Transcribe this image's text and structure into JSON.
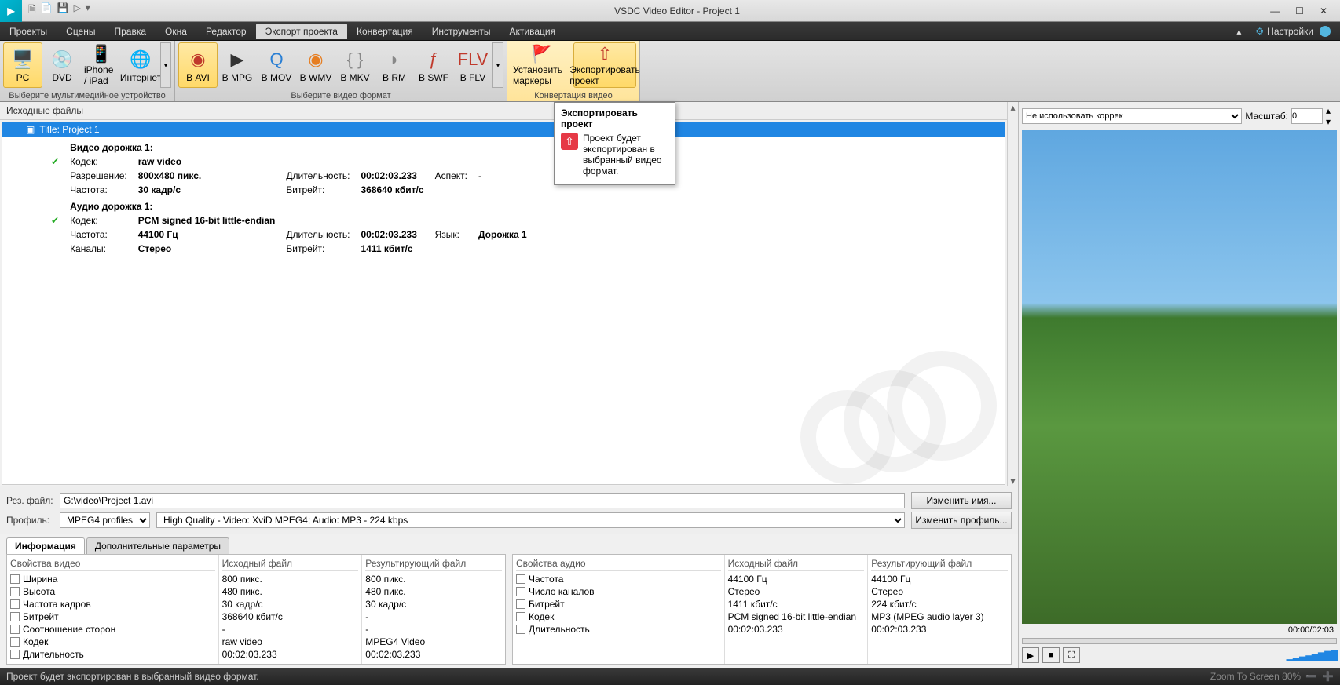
{
  "app": {
    "title": "VSDC Video Editor - Project 1"
  },
  "menu": {
    "items": [
      "Проекты",
      "Сцены",
      "Правка",
      "Окна",
      "Редактор",
      "Экспорт проекта",
      "Конвертация",
      "Инструменты",
      "Активация"
    ],
    "active": 5,
    "settings": "Настройки"
  },
  "ribbon": {
    "devices": {
      "label": "Выберите мультимедийное устройство",
      "items": [
        {
          "t": "PC",
          "ic": "🖥️",
          "sel": true
        },
        {
          "t": "DVD",
          "ic": "💿"
        },
        {
          "t": "iPhone / iPad",
          "ic": "📱"
        },
        {
          "t": "Интернет",
          "ic": "🌐"
        }
      ]
    },
    "formats": {
      "label": "Выберите видео формат",
      "items": [
        {
          "t": "В AVI",
          "ic": "◉",
          "sel": true,
          "col": "#c0392b"
        },
        {
          "t": "В MPG",
          "ic": "▶",
          "col": "#333"
        },
        {
          "t": "В MOV",
          "ic": "Q",
          "col": "#2a7fd4"
        },
        {
          "t": "В WMV",
          "ic": "◉",
          "col": "#e67e22"
        },
        {
          "t": "В MKV",
          "ic": "{ }",
          "col": "#888"
        },
        {
          "t": "В RM",
          "ic": "◗",
          "col": "#888"
        },
        {
          "t": "В SWF",
          "ic": "ƒ",
          "col": "#c0392b"
        },
        {
          "t": "В FLV",
          "ic": "FLV",
          "col": "#c0392b"
        }
      ]
    },
    "convert": {
      "label": "Конвертация видео",
      "items": [
        {
          "t": "Установить маркеры",
          "ic": "🚩",
          "col": "#c0392b"
        },
        {
          "t": "Экспортировать проект",
          "ic": "⇧",
          "col": "#c0392b",
          "sel": true
        }
      ]
    }
  },
  "sources": {
    "label": "Исходные файлы",
    "title": "Title: Project 1",
    "video": {
      "hdr": "Видео дорожка 1:",
      "codec_l": "Кодек:",
      "codec": "raw video",
      "res_l": "Разрешение:",
      "res": "800x480 пикс.",
      "dur_l": "Длительность:",
      "dur": "00:02:03.233",
      "asp_l": "Аспект:",
      "asp": "-",
      "fps_l": "Частота:",
      "fps": "30 кадр/с",
      "br_l": "Битрейт:",
      "br": "368640 кбит/с"
    },
    "audio": {
      "hdr": "Аудио дорожка 1:",
      "codec_l": "Кодек:",
      "codec": "PCM signed 16-bit little-endian",
      "freq_l": "Частота:",
      "freq": "44100 Гц",
      "dur_l": "Длительность:",
      "dur": "00:02:03.233",
      "lang_l": "Язык:",
      "lang": "Дорожка 1",
      "ch_l": "Каналы:",
      "ch": "Стерео",
      "br_l": "Битрейт:",
      "br": "1411 кбит/с"
    }
  },
  "tooltip": {
    "title": "Экспортировать проект",
    "body": "Проект будет экспортирован в выбранный видео формат."
  },
  "preview": {
    "correction": "Не использовать коррек",
    "scale_l": "Масштаб:",
    "scale": "0",
    "time": "00:00/02:03"
  },
  "form": {
    "file_l": "Рез. файл:",
    "file": "G:\\video\\Project 1.avi",
    "change_name": "Изменить имя...",
    "profile_l": "Профиль:",
    "profile": "MPEG4 profiles",
    "quality": "High Quality - Video: XviD MPEG4; Audio: MP3 - 224 kbps",
    "change_profile": "Изменить профиль..."
  },
  "tabs": {
    "info": "Информация",
    "extra": "Дополнительные параметры"
  },
  "vp": {
    "hd1": "Свойства видео",
    "hd2": "Исходный файл",
    "hd3": "Результирующий файл",
    "rows": [
      {
        "n": "Ширина",
        "a": "800 пикс.",
        "b": "800 пикс."
      },
      {
        "n": "Высота",
        "a": "480 пикс.",
        "b": "480 пикс."
      },
      {
        "n": "Частота кадров",
        "a": "30 кадр/с",
        "b": "30 кадр/с"
      },
      {
        "n": "Битрейт",
        "a": "368640 кбит/с",
        "b": "-"
      },
      {
        "n": "Соотношение сторон",
        "a": "-",
        "b": "-"
      },
      {
        "n": "Кодек",
        "a": "raw video",
        "b": "MPEG4 Video"
      },
      {
        "n": "Длительность",
        "a": "00:02:03.233",
        "b": "00:02:03.233"
      }
    ]
  },
  "ap": {
    "hd1": "Свойства аудио",
    "hd2": "Исходный файл",
    "hd3": "Результирующий файл",
    "rows": [
      {
        "n": "Частота",
        "a": "44100 Гц",
        "b": "44100 Гц"
      },
      {
        "n": "Число каналов",
        "a": "Стерео",
        "b": "Стерео"
      },
      {
        "n": "Битрейт",
        "a": "1411 кбит/с",
        "b": "224 кбит/с"
      },
      {
        "n": "Кодек",
        "a": "PCM signed 16-bit little-endian",
        "b": "MP3 (MPEG audio layer 3)"
      },
      {
        "n": "Длительность",
        "a": "00:02:03.233",
        "b": "00:02:03.233"
      }
    ]
  },
  "status": {
    "msg": "Проект будет экспортирован в выбранный видео формат.",
    "zoom": "Zoom To Screen   80%"
  }
}
